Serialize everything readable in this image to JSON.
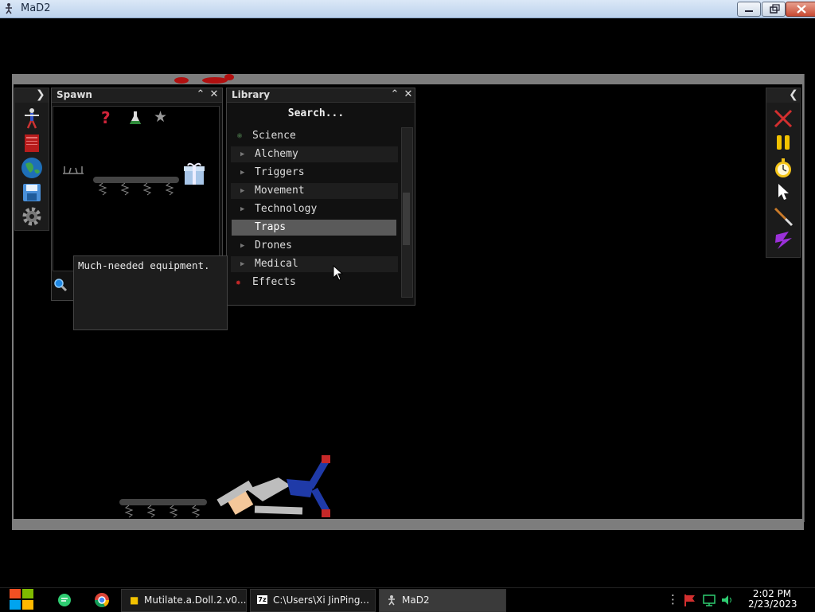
{
  "window": {
    "title": "MaD2"
  },
  "spawn": {
    "title": "Spawn"
  },
  "library": {
    "title": "Library",
    "search_placeholder": "Search...",
    "items": [
      {
        "label": "Science",
        "type": "category"
      },
      {
        "label": "Alchemy",
        "type": "child"
      },
      {
        "label": "Triggers",
        "type": "child"
      },
      {
        "label": "Movement",
        "type": "child"
      },
      {
        "label": "Technology",
        "type": "child"
      },
      {
        "label": "Traps",
        "type": "selected"
      },
      {
        "label": "Drones",
        "type": "child"
      },
      {
        "label": "Medical",
        "type": "child"
      },
      {
        "label": "Effects",
        "type": "category"
      }
    ]
  },
  "tooltip": {
    "text": "Much-needed equipment."
  },
  "taskbar": {
    "items": [
      {
        "label": "Mutilate.a.Doll.2.v0..."
      },
      {
        "label": "C:\\Users\\Xi JinPing..."
      },
      {
        "label": "MaD2"
      }
    ],
    "time": "2:02 PM",
    "date": "2/23/2023"
  },
  "colors": {
    "accent_red": "#cc1f1f",
    "doll_blue": "#1f3aa8",
    "panel_bg": "#111111"
  }
}
